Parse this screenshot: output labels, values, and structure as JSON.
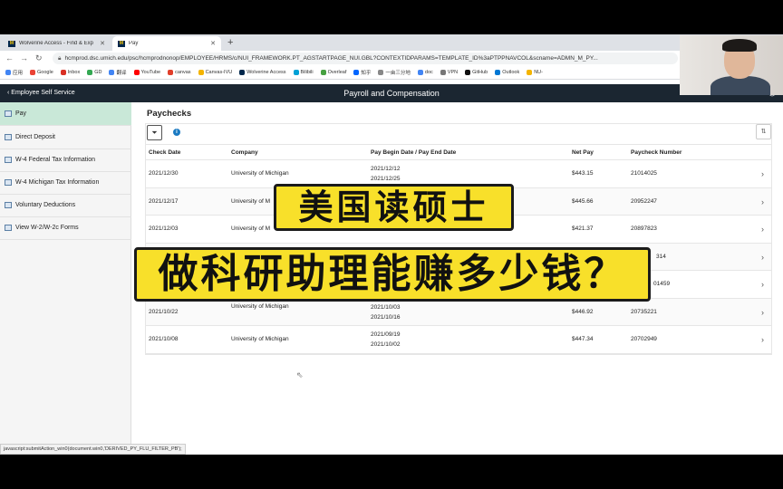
{
  "browser": {
    "tabs": [
      {
        "title": "Wolverine Access - Find & Exp",
        "active": false
      },
      {
        "title": "Pay",
        "active": true
      }
    ],
    "url": "hcmprod.dsc.umich.edu/psc/hcmprodnonop/EMPLOYEE/HRMS/c/NUI_FRAMEWORK.PT_AGSTARTPAGE_NUI.GBL?CONTEXTIDPARAMS=TEMPLATE_ID%3aPTPPNAVCOL&scname=ADMN_M_PY...",
    "bookmarks": [
      "应用",
      "Google",
      "Inbox",
      "GD",
      "翻译",
      "YouTube",
      "canvas",
      "Canvas-IVU",
      "Wolverine Access",
      "Bilibili",
      "Overleaf",
      "知乎",
      "一亩三分地",
      "doc",
      "VPN",
      "GitHub",
      "Outlook",
      "NU-"
    ],
    "status_text": "javascript:submitAction_win0(document.win0,'DERIVED_PY_FLU_FILTER_PB');"
  },
  "header": {
    "back_label": "Employee Self Service",
    "title": "Payroll and Compensation"
  },
  "sidebar": {
    "items": [
      {
        "label": "Pay"
      },
      {
        "label": "Direct Deposit"
      },
      {
        "label": "W-4 Federal Tax Information"
      },
      {
        "label": "W-4 Michigan Tax Information"
      },
      {
        "label": "Voluntary Deductions"
      },
      {
        "label": "View W-2/W-2c Forms"
      }
    ]
  },
  "main": {
    "title": "Paychecks",
    "columns": {
      "check_date": "Check Date",
      "company": "Company",
      "pay_period": "Pay Begin Date / Pay End Date",
      "net_pay": "Net Pay",
      "paycheck_number": "Paycheck Number"
    },
    "rows": [
      {
        "check_date": "2021/12/30",
        "company": "University of Michigan",
        "begin": "2021/12/12",
        "end": "2021/12/25",
        "net_pay": "$443.15",
        "number": "21014025"
      },
      {
        "check_date": "2021/12/17",
        "company": "University of M",
        "begin": "",
        "end": "",
        "net_pay": "$445.66",
        "number": "20952247"
      },
      {
        "check_date": "2021/12/03",
        "company": "University of M",
        "begin": "",
        "end": "",
        "net_pay": "$421.37",
        "number": "20897823"
      },
      {
        "check_date": "",
        "company": "",
        "begin": "",
        "end": "",
        "net_pay": "",
        "number": "314"
      },
      {
        "check_date": "",
        "company": "",
        "begin": "",
        "end": "",
        "net_pay": "",
        "number": "01459"
      },
      {
        "check_date": "2021/10/22",
        "company": "University of Michigan",
        "begin": "2021/10/03",
        "end": "2021/10/16",
        "net_pay": "$446.92",
        "number": "20735221"
      },
      {
        "check_date": "2021/10/08",
        "company": "University of Michigan",
        "begin": "2021/09/19",
        "end": "2021/10/02",
        "net_pay": "$447.34",
        "number": "20702949"
      }
    ]
  },
  "overlay": {
    "line1": "美国读硕士",
    "line2": "做科研助理能赚多少钱？"
  },
  "colors": {
    "header_bg": "#1b2631",
    "active_sidebar": "#c9e8d8",
    "banner": "#f8e02a",
    "info": "#1b7ac2"
  }
}
